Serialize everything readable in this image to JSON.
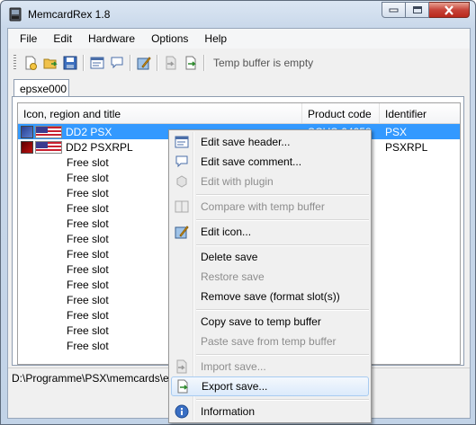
{
  "window": {
    "title": "MemcardRex 1.8"
  },
  "menubar": [
    "File",
    "Edit",
    "Hardware",
    "Options",
    "Help"
  ],
  "toolbar": {
    "status": "Temp buffer is empty"
  },
  "tab": {
    "label": "epsxe000"
  },
  "list": {
    "columns": [
      "Icon, region and title",
      "Product code",
      "Identifier"
    ],
    "rows": [
      {
        "title": "DD2  PSX",
        "product": "SCUS-94258",
        "identifier": "PSX",
        "selected": true,
        "type": "save"
      },
      {
        "title": "DD2  PSXRPL",
        "product": "",
        "identifier": "PSXRPL",
        "selected": false,
        "type": "save"
      },
      {
        "title": "Free slot",
        "type": "free"
      },
      {
        "title": "Free slot",
        "type": "free"
      },
      {
        "title": "Free slot",
        "type": "free"
      },
      {
        "title": "Free slot",
        "type": "free"
      },
      {
        "title": "Free slot",
        "type": "free"
      },
      {
        "title": "Free slot",
        "type": "free"
      },
      {
        "title": "Free slot",
        "type": "free"
      },
      {
        "title": "Free slot",
        "type": "free"
      },
      {
        "title": "Free slot",
        "type": "free"
      },
      {
        "title": "Free slot",
        "type": "free"
      },
      {
        "title": "Free slot",
        "type": "free"
      },
      {
        "title": "Free slot",
        "type": "free"
      },
      {
        "title": "Free slot",
        "type": "free"
      }
    ]
  },
  "statusbar": {
    "path": "D:\\Programme\\PSX\\memcards\\epsxe000.mcr"
  },
  "context_menu": {
    "items": [
      {
        "label": "Edit save header...",
        "enabled": true,
        "icon": "header-icon"
      },
      {
        "label": "Edit save comment...",
        "enabled": true,
        "icon": "comment-icon"
      },
      {
        "label": "Edit with plugin",
        "enabled": false,
        "icon": "plugin-icon"
      },
      {
        "label": "Compare with temp buffer",
        "enabled": false,
        "icon": "compare-icon"
      },
      {
        "label": "Edit icon...",
        "enabled": true,
        "icon": "edit-icon-icon"
      },
      {
        "label": "Delete save",
        "enabled": true,
        "icon": ""
      },
      {
        "label": "Restore save",
        "enabled": false,
        "icon": ""
      },
      {
        "label": "Remove save (format slot(s))",
        "enabled": true,
        "icon": ""
      },
      {
        "label": "Copy save to temp buffer",
        "enabled": true,
        "icon": ""
      },
      {
        "label": "Paste save from temp buffer",
        "enabled": false,
        "icon": ""
      },
      {
        "label": "Import save...",
        "enabled": false,
        "icon": "import-icon"
      },
      {
        "label": "Export save...",
        "enabled": true,
        "icon": "export-icon",
        "highlighted": true
      },
      {
        "label": "Information",
        "enabled": true,
        "icon": "info-icon"
      }
    ]
  },
  "colors": {
    "selection": "#3399ff",
    "menu_highlight": "#dbeafb"
  }
}
